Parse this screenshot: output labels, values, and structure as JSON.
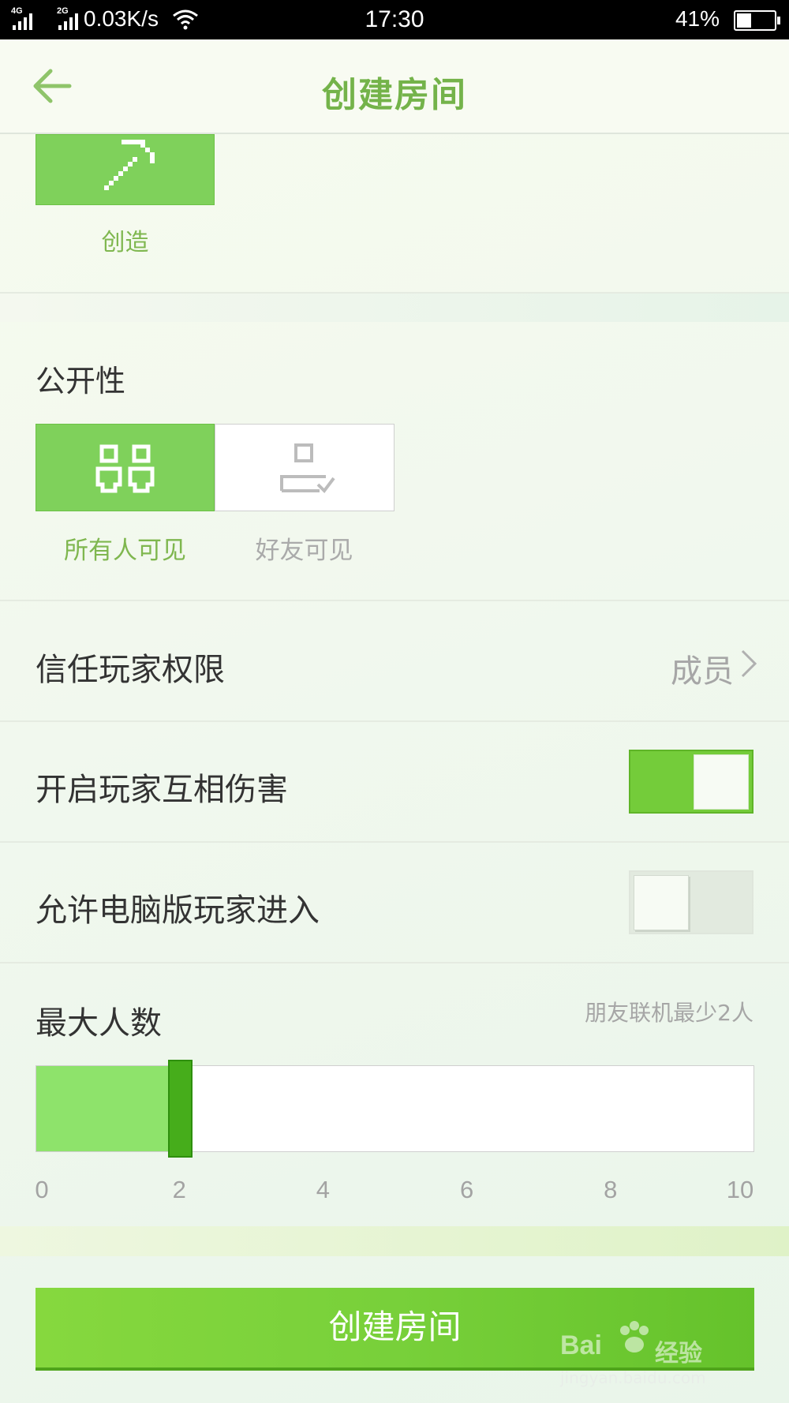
{
  "status_bar": {
    "network_1": "4G",
    "network_2": "2G",
    "speed": "0.03K/s",
    "time": "17:30",
    "battery": "41%"
  },
  "header": {
    "title": "创建房间"
  },
  "game_mode": {
    "label": "创造"
  },
  "visibility": {
    "title": "公开性",
    "options": [
      {
        "label": "所有人可见",
        "selected": true
      },
      {
        "label": "好友可见",
        "selected": false
      }
    ]
  },
  "trust_permission": {
    "label": "信任玩家权限",
    "value": "成员"
  },
  "pvp": {
    "label": "开启玩家互相伤害",
    "enabled": true
  },
  "pc_players": {
    "label": "允许电脑版玩家进入",
    "enabled": false
  },
  "max_players": {
    "label": "最大人数",
    "hint": "朋友联机最少2人",
    "value": 2,
    "min": 0,
    "max": 10,
    "ticks": [
      "0",
      "2",
      "4",
      "6",
      "8",
      "10"
    ]
  },
  "create_button": {
    "label": "创建房间"
  },
  "watermark": {
    "text": "Bai",
    "text_cn": "经验",
    "url": "jingyan.baidu.com"
  },
  "colors": {
    "accent": "#74b34a",
    "tile_green": "#7fd15b",
    "toggle_on": "#74cc3a",
    "slider_fill": "#8ee36b",
    "slider_thumb": "#46ad1b"
  }
}
